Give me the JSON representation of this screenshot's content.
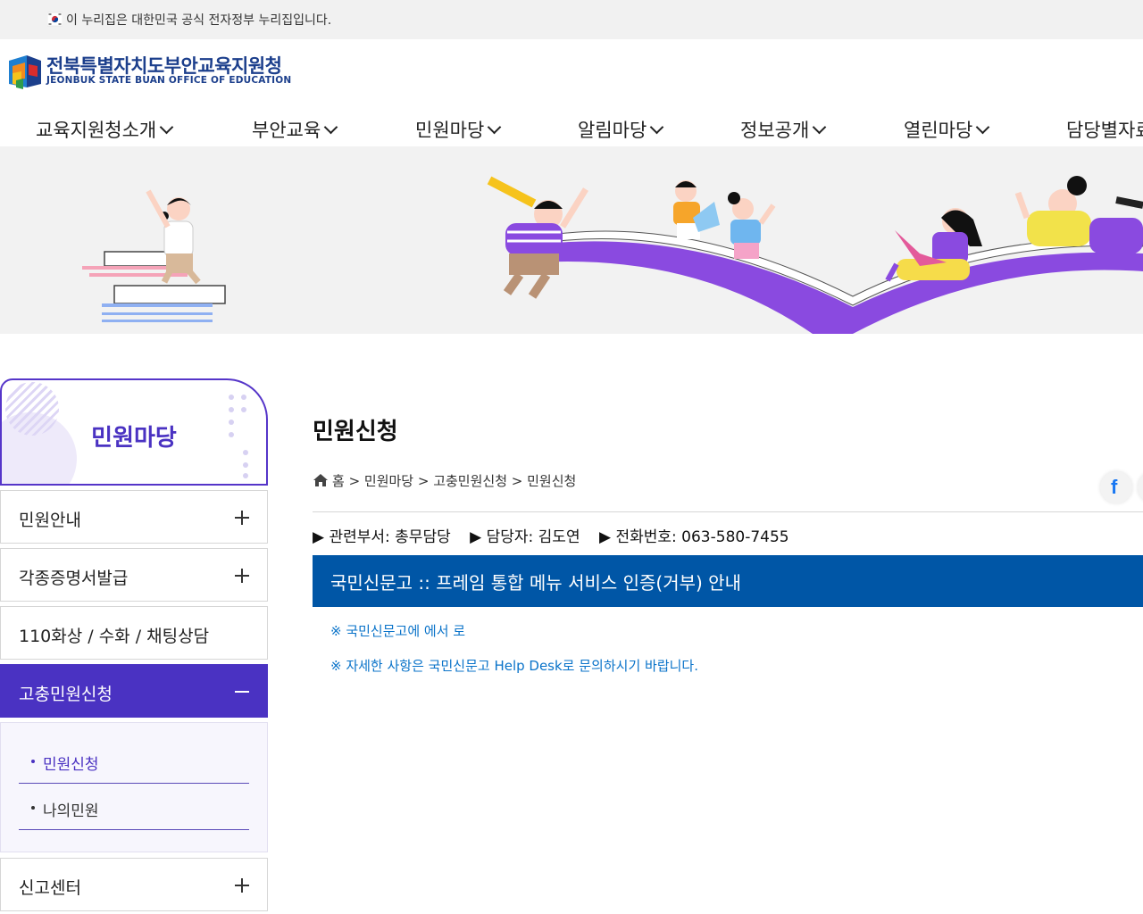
{
  "gov_banner": {
    "text": "이 누리집은 대한민국 공식 전자정부 누리집입니다."
  },
  "logo": {
    "name_ko": "전북특별자치도부안교육지원청",
    "name_en": "JEONBUK STATE BUAN OFFICE OF EDUCATION"
  },
  "gnb": {
    "items": [
      {
        "label": "교육지원청소개"
      },
      {
        "label": "부안교육"
      },
      {
        "label": "민원마당"
      },
      {
        "label": "알림마당"
      },
      {
        "label": "정보공개"
      },
      {
        "label": "열린마당"
      },
      {
        "label": "담당별자료"
      }
    ]
  },
  "sidebar": {
    "title": "민원마당",
    "items": [
      {
        "label": "민원안내"
      },
      {
        "label": "각종증명서발급"
      },
      {
        "label": "110화상 / 수화 / 채팅상담"
      },
      {
        "label": "고충민원신청"
      },
      {
        "label": "신고센터"
      }
    ],
    "sub_items": [
      {
        "label": "민원신청"
      },
      {
        "label": "나의민원"
      }
    ]
  },
  "content": {
    "title": "민원신청",
    "breadcrumb": "홈 > 민원마당 > 고충민원신청 > 민원신청",
    "info": {
      "dept": "▶ 관련부서: 총무담당",
      "person": "▶ 담당자: 김도연",
      "phone": "▶ 전화번호: 063-580-7455"
    },
    "notice_title": "국민신문고 :: 프레임 통합 메뉴 서비스 인증(거부) 안내",
    "lines": [
      "※ 국민신문고에 에서 로",
      "※ 자세한 사항은 국민신문고 Help Desk로 문의하시기 바랍니다."
    ]
  },
  "colors": {
    "primary": "#4a32c2",
    "notice_blue": "#0056a6",
    "link_blue": "#0a73c9",
    "logo_navy": "#1c3f8c"
  }
}
